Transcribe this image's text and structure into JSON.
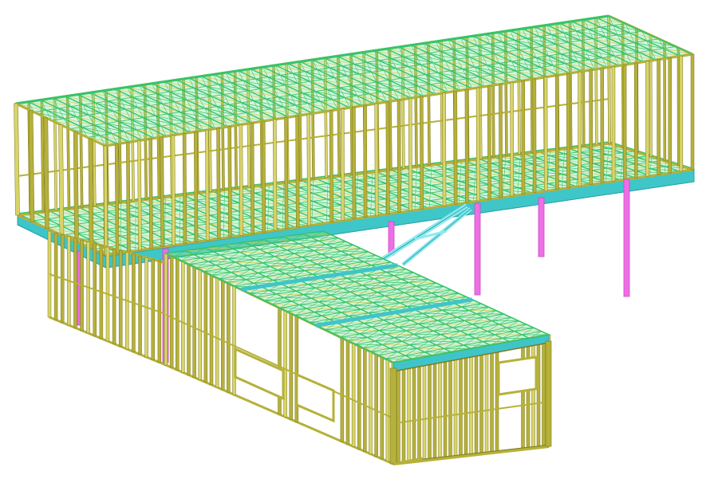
{
  "scene": {
    "background": "#ffffff",
    "palette": {
      "stud": "#b5b13a",
      "stud_light": "#d8d46a",
      "stud_outline": "#7e7a20",
      "truss": "#35c46a",
      "truss_light": "#7fe39a",
      "truss_web": "#d7c84a",
      "joist": "#3fc5c9",
      "joist_dark": "#2aa3a6",
      "column": "#ee6ee6",
      "column_dark": "#c84dc2",
      "brace": "#8ee9f0"
    },
    "components": [
      {
        "name": "upper-roof-trusses",
        "type": "roof"
      },
      {
        "name": "upper-wall-studs",
        "type": "wall"
      },
      {
        "name": "upper-floor-deck",
        "type": "floor"
      },
      {
        "name": "lower-roof-trusses",
        "type": "roof"
      },
      {
        "name": "lower-wall-studs",
        "type": "wall"
      },
      {
        "name": "support-columns",
        "type": "column"
      },
      {
        "name": "diagonal-braces",
        "type": "brace"
      }
    ]
  }
}
